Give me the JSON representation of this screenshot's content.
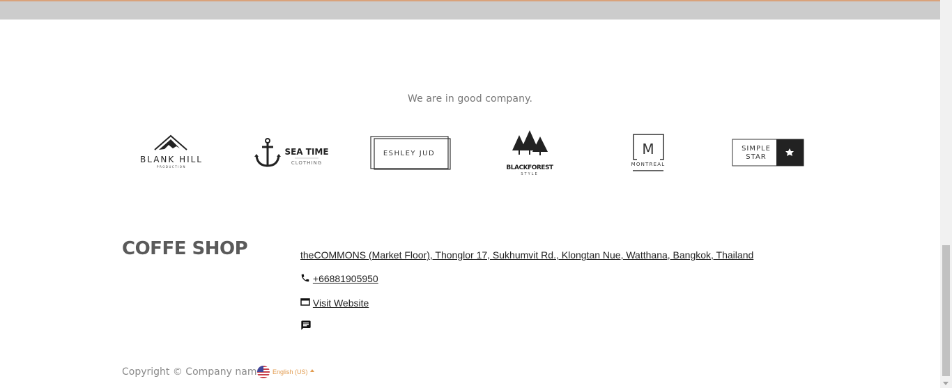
{
  "tagline": "We are in good company.",
  "logos": [
    {
      "name": "BLANK HILL",
      "sub": "PRODUCTION"
    },
    {
      "name": "SEA TIME",
      "sub": "CLOTHING"
    },
    {
      "name": "ESHLEY JUD",
      "sub": ""
    },
    {
      "name": "BLACKFOREST",
      "sub": "STYLE"
    },
    {
      "name": "MONTREAL",
      "sub": "M"
    },
    {
      "name_line1": "SIMPLE",
      "name_line2": "STAR"
    }
  ],
  "footer": {
    "brand": "COFFE SHOP",
    "address": "theCOMMONS (Market Floor), Thonglor 17, Sukhumvit Rd., Klongtan Nue, Watthana, Bangkok, Thailand",
    "phone": "+66881905950",
    "website_label": "Visit Website",
    "message_label": " ",
    "copyright": "Copyright © Company name",
    "language": "English (US)"
  },
  "colors": {
    "accent": "#e29c50",
    "topbar": "#cccccc"
  },
  "icons": {
    "phone": "phone-icon",
    "website": "window-icon",
    "message": "chat-icon",
    "flag": "us-flag-icon"
  }
}
